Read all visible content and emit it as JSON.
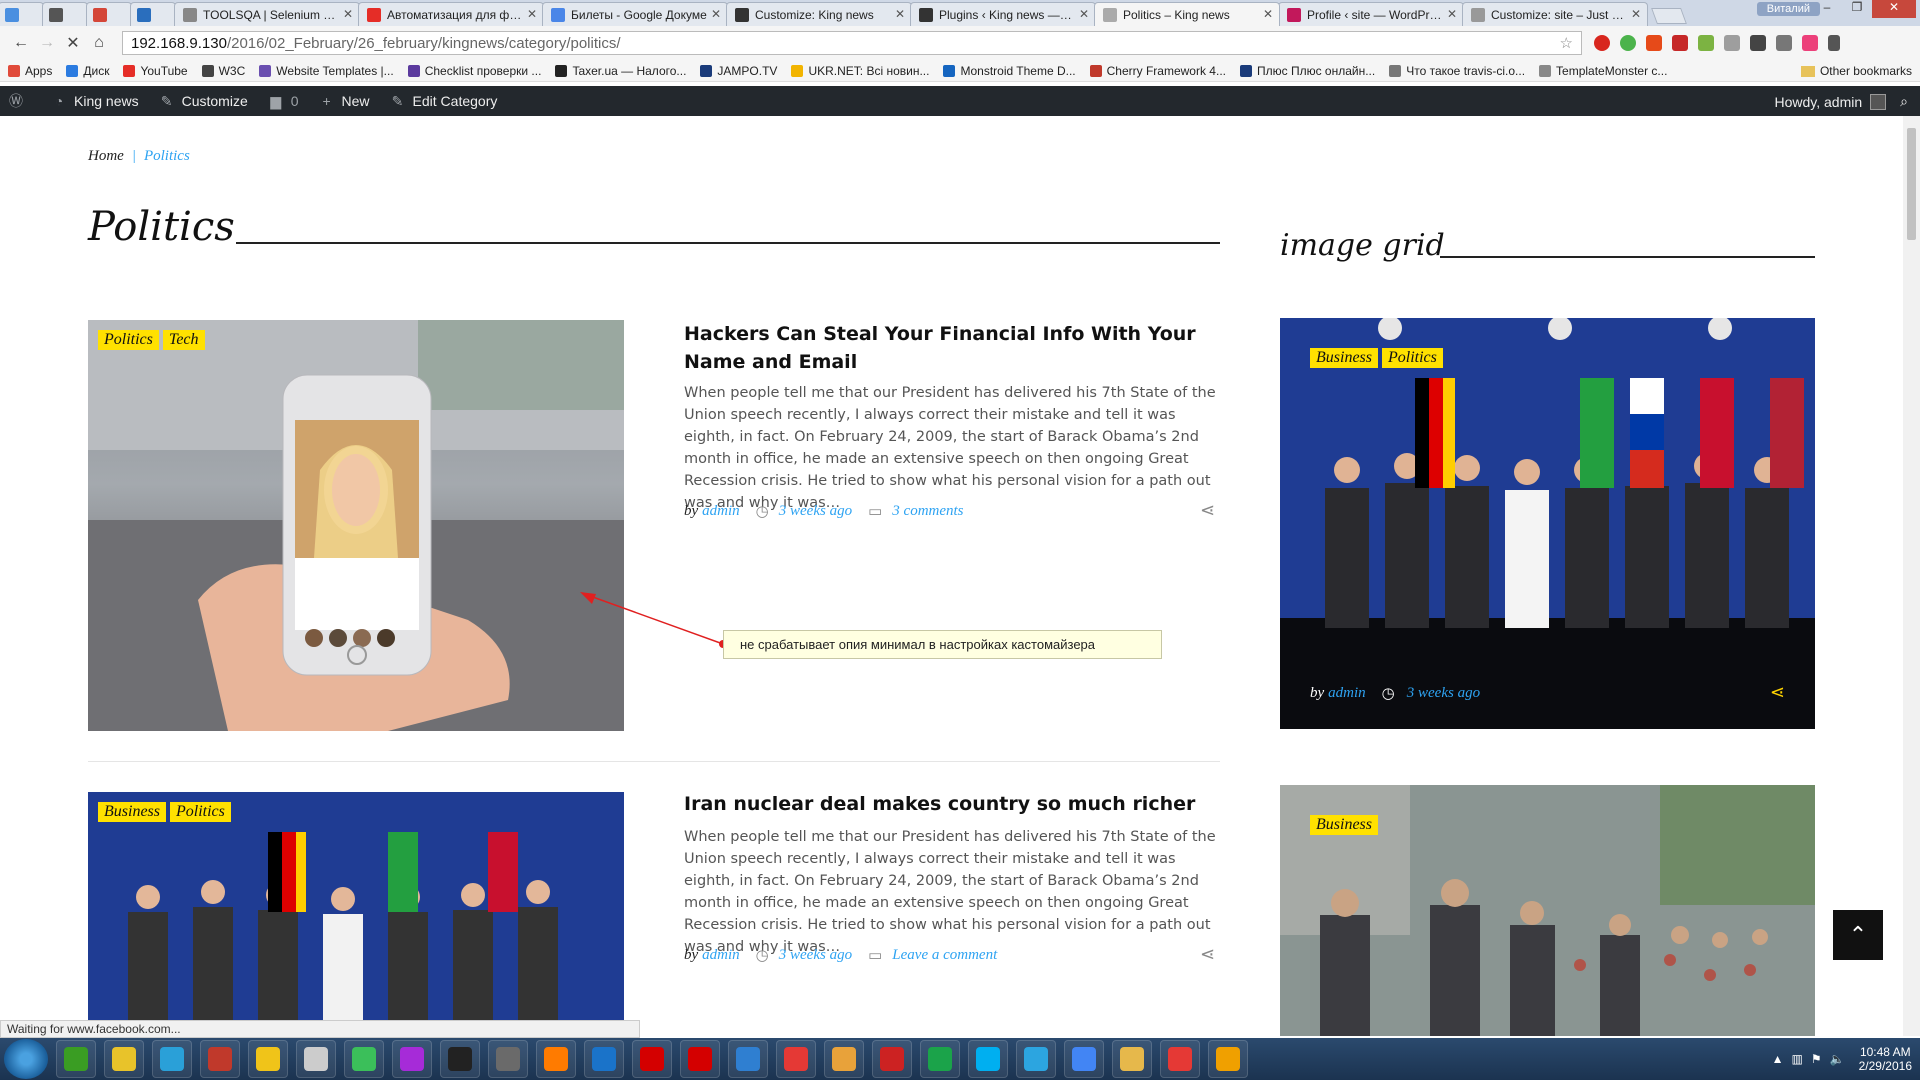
{
  "browser": {
    "tabs": [
      {
        "title": "",
        "color": "#4a8fe0",
        "active": false,
        "small": true
      },
      {
        "title": "",
        "color": "#555555",
        "active": false,
        "small": true
      },
      {
        "title": "",
        "color": "#d44638",
        "active": false,
        "small": true
      },
      {
        "title": "",
        "color": "#2a6ebd",
        "active": false,
        "small": true
      },
      {
        "title": "TOOLSQA | Selenium Web",
        "color": "#888888",
        "active": false,
        "small": false
      },
      {
        "title": "Автоматизация для фрон",
        "color": "#e52d27",
        "active": false,
        "small": false
      },
      {
        "title": "Билеты - Google Докуме",
        "color": "#4a86e8",
        "active": false,
        "small": false
      },
      {
        "title": "Customize: King news",
        "color": "#333333",
        "active": false,
        "small": false
      },
      {
        "title": "Plugins ‹ King news — Wo",
        "color": "#333333",
        "active": false,
        "small": false
      },
      {
        "title": "Politics – King news",
        "color": "#aaaaaa",
        "active": true,
        "small": false
      },
      {
        "title": "Profile ‹ site — WordPress",
        "color": "#c2185b",
        "active": false,
        "small": false
      },
      {
        "title": "Customize: site – Just ano",
        "color": "#999999",
        "active": false,
        "small": false
      }
    ],
    "user": "Виталий",
    "url_host": "192.168.9.130",
    "url_path": "/2016/02_February/26_february/kingnews/category/politics/",
    "bookmarks": [
      "Apps",
      "Диск",
      "YouTube",
      "W3C",
      "Website Templates |...",
      "Checklist проверки ...",
      "Taxer.ua — Налого...",
      "JAMPO.TV",
      "UKR.NET: Всі новин...",
      "Monstroid Theme D...",
      "Cherry Framework 4...",
      "Плюс Плюс онлайн...",
      "Что такое travis-ci.o...",
      "TemplateMonster c..."
    ],
    "other_bookmarks": "Other bookmarks",
    "status": "Waiting for www.facebook.com..."
  },
  "wp_admin": {
    "site": "King news",
    "customize": "Customize",
    "comments": "0",
    "new": "New",
    "edit": "Edit Category",
    "howdy": "Howdy, admin"
  },
  "page": {
    "breadcrumb": {
      "home": "Home",
      "sep": "|",
      "current": "Politics"
    },
    "title": "Politics",
    "sidebar_title": "image grid",
    "posts": [
      {
        "tags": [
          "Politics",
          "Tech"
        ],
        "title": "Hackers Can Steal Your Financial Info With Your Name and Email",
        "excerpt": "When people tell me that our President has delivered his 7th State of the Union speech recently, I always correct their mistake and tell it was eighth, in fact. On February 24, 2009, the start of Barack Obama’s 2nd month in office, he made an extensive speech on then ongoing Great Recession crisis. He tried to show what his personal vision for a path out was and why it was…",
        "by": "by",
        "author": "admin",
        "date": "3 weeks ago",
        "comments": "3 comments"
      },
      {
        "tags": [
          "Business",
          "Politics"
        ],
        "title": "Iran nuclear deal makes country so much richer",
        "excerpt": "When people tell me that our President has delivered his 7th State of the Union speech recently, I always correct their mistake and tell it was eighth, in fact. On February 24, 2009, the start of Barack Obama’s 2nd month in office, he made an extensive speech on then ongoing Great Recession crisis. He tried to show what his personal vision for a path out was and why it was…",
        "by": "by",
        "author": "admin",
        "date": "3 weeks ago",
        "comments": "Leave a comment"
      }
    ],
    "grid": [
      {
        "tags": [
          "Business",
          "Politics"
        ],
        "by": "by",
        "author": "admin",
        "date": "3 weeks ago"
      },
      {
        "tags": [
          "Business"
        ]
      }
    ],
    "annotation": "не срабатывает опия минимал в настройках кастомайзера",
    "colors": {
      "accent": "#2ea3f2",
      "tag_bg": "#ffe100",
      "admin_bar": "#23282d"
    }
  },
  "taskbar": {
    "time": "10:48 AM",
    "date": "2/29/2016",
    "apps": [
      "#3a9d23",
      "#e8c32a",
      "#2aa0d8",
      "#c0392b",
      "#f0c419",
      "#cccccc",
      "#3bbf5a",
      "#a62bd8",
      "#222222",
      "#6a6a6a",
      "#ff7b00",
      "#1a73c9",
      "#d40000",
      "#d40000",
      "#2f7fd1",
      "#e53935",
      "#e8a23a",
      "#cc2222",
      "#1ba34a",
      "#00aff0",
      "#2ca5e0",
      "#4285f4",
      "#e6b84b",
      "#e53935",
      "#f0a000"
    ]
  }
}
